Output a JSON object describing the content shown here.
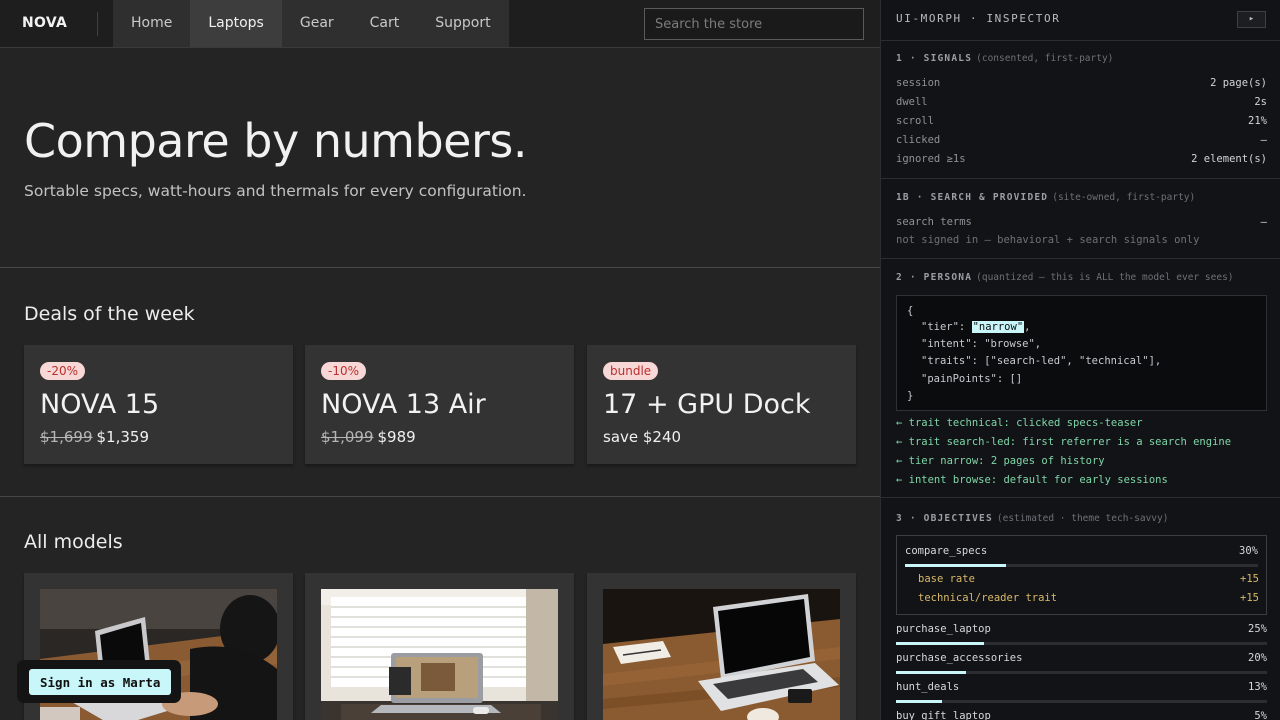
{
  "store": {
    "brand": "NOVA",
    "nav": [
      "Home",
      "Laptops",
      "Gear",
      "Cart",
      "Support"
    ],
    "active_nav": "Laptops",
    "search_placeholder": "Search the store",
    "hero": {
      "title": "Compare by numbers.",
      "subtitle": "Sortable specs, watt-hours and thermals for every configuration."
    },
    "deals_title": "Deals of the week",
    "deals": [
      {
        "badge": "-20%",
        "name": "NOVA 15",
        "old_price": "$1,699",
        "price": "$1,359"
      },
      {
        "badge": "-10%",
        "name": "NOVA 13 Air",
        "old_price": "$1,099",
        "price": "$989"
      },
      {
        "badge": "bundle",
        "name": "17 + GPU Dock",
        "old_price": "",
        "price": "save $240"
      }
    ],
    "models_title": "All models",
    "signin_label": "Sign in as Marta"
  },
  "inspector": {
    "title": "UI-MORPH · INSPECTOR",
    "toggle": "▸",
    "signals": {
      "heading": "1 · SIGNALS",
      "note": "(consented, first-party)",
      "rows": [
        {
          "key": "session",
          "value": "2 page(s)"
        },
        {
          "key": "dwell",
          "value": "2s"
        },
        {
          "key": "scroll",
          "value": "21%"
        },
        {
          "key": "clicked",
          "value": "—"
        },
        {
          "key": "ignored ≥1s",
          "value": "2 element(s)"
        }
      ]
    },
    "search_provided": {
      "heading": "1B · SEARCH & PROVIDED",
      "note": "(site-owned, first-party)",
      "search_terms_key": "search terms",
      "search_terms_value": "—",
      "not_signed_in": "not signed in — behavioral + search signals only"
    },
    "persona": {
      "heading": "2 · PERSONA",
      "note": "(quantized — this is ALL the model ever sees)",
      "json_open": "{",
      "json_close": "}",
      "tier_key": "\"tier\": ",
      "tier_value": "\"narrow\"",
      "tier_tail": ",",
      "intent_line": "\"intent\": \"browse\",",
      "traits_line": "\"traits\": [\"search-led\", \"technical\"],",
      "pain_line": "\"painPoints\": []",
      "traces": [
        "← trait technical: clicked specs-teaser",
        "← trait search-led: first referrer is a search engine",
        "← tier narrow: 2 pages of history",
        "← intent browse: default for early sessions"
      ]
    },
    "objectives": {
      "heading": "3 · OBJECTIVES",
      "note": "(estimated · theme tech-savvy)",
      "top": {
        "name": "compare_specs",
        "percent": "30%",
        "level": 0.3,
        "contributions": [
          {
            "label": "base rate",
            "value": "+15"
          },
          {
            "label": "technical/reader trait",
            "value": "+15"
          }
        ]
      },
      "others": [
        {
          "name": "purchase_laptop",
          "percent": "25%",
          "level": 0.25
        },
        {
          "name": "purchase_accessories",
          "percent": "20%",
          "level": 0.2
        },
        {
          "name": "hunt_deals",
          "percent": "13%",
          "level": 0.13
        },
        {
          "name": "buy_gift_laptop",
          "percent": "5%",
          "level": 0.05
        }
      ]
    }
  },
  "colors": {
    "accent": "#c9f6f8",
    "badge_bg": "#f8d7d7",
    "badge_text": "#b8322f",
    "trace_green": "#7fd6a8",
    "contrib_gold": "#d9b86a"
  }
}
